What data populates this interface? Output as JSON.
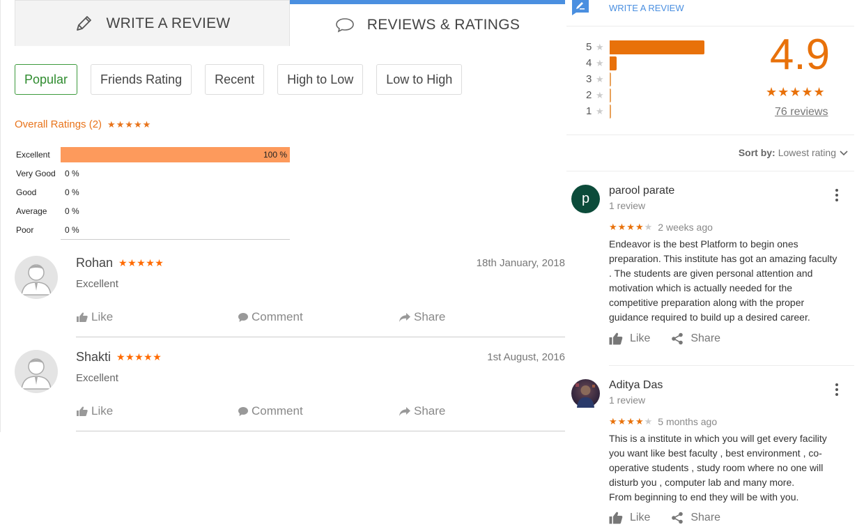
{
  "tabs": {
    "write_review": "WRITE A REVIEW",
    "reviews_ratings": "REVIEWS & RATINGS"
  },
  "filters": [
    "Popular",
    "Friends Rating",
    "Recent",
    "High to Low",
    "Low to High"
  ],
  "overall": {
    "label": "Overall Ratings (2)",
    "stars": "★★★★★"
  },
  "distribution": [
    {
      "label": "Excellent",
      "percent": 100,
      "text": "100 %"
    },
    {
      "label": "Very Good",
      "percent": 0,
      "text": "0 %"
    },
    {
      "label": "Good",
      "percent": 0,
      "text": "0 %"
    },
    {
      "label": "Average",
      "percent": 0,
      "text": "0 %"
    },
    {
      "label": "Poor",
      "percent": 0,
      "text": "0 %"
    }
  ],
  "reviews": [
    {
      "name": "Rohan",
      "stars": "★★★★★",
      "date": "18th January, 2018",
      "text": "Excellent",
      "like": "Like",
      "comment": "Comment",
      "share": "Share"
    },
    {
      "name": "Shakti",
      "stars": "★★★★★",
      "date": "1st August, 2016",
      "text": "Excellent",
      "like": "Like",
      "comment": "Comment",
      "share": "Share"
    }
  ],
  "google": {
    "write_review": "WRITE A REVIEW",
    "histogram": [
      {
        "level": "5",
        "fraction": 1.0
      },
      {
        "level": "4",
        "fraction": 0.07
      },
      {
        "level": "3",
        "fraction": 0.0
      },
      {
        "level": "2",
        "fraction": 0.0
      },
      {
        "level": "1",
        "fraction": 0.0
      }
    ],
    "score": "4.9",
    "score_stars": "★★★★★",
    "review_count": "76 reviews",
    "sort_label": "Sort by:",
    "sort_value": "Lowest rating",
    "reviews": [
      {
        "initial": "p",
        "name": "parool parate",
        "count": "1 review",
        "stars_on": "★★★★",
        "stars_off": "★",
        "ago": "2 weeks ago",
        "text": "Endeavor is the best Platform to begin ones\npreparation. This institute has got an amazing faculty\n. The students are given personal attention and\nmotivation which is actually needed for the\ncompetitive preparation along with the proper\nguidance required to build up a desired career.",
        "like": "Like",
        "share": "Share"
      },
      {
        "initial": "",
        "name": "Aditya Das",
        "count": "1 review",
        "stars_on": "★★★★",
        "stars_off": "★",
        "ago": "5 months ago",
        "text": "This is a institute in which you will get every facility\nyou want like best faculty , best environment , co-\noperative students , study room where no one will\ndisturb you , computer lab and many more.\nFrom beginning to end they will be with you.",
        "like": "Like",
        "share": "Share"
      }
    ]
  },
  "colors": {
    "accent_orange": "#e8710a",
    "bar_orange": "#fd9a5c",
    "link_blue": "#4a8fe0",
    "selected_green": "#2e8b2e"
  }
}
